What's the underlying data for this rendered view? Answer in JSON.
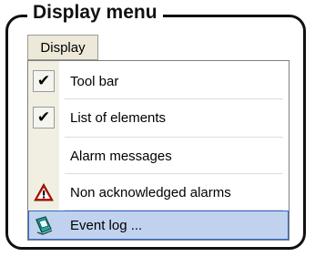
{
  "frame": {
    "title": "Display menu"
  },
  "menubar": {
    "display_label": "Display"
  },
  "menu": {
    "items": [
      {
        "label": "Tool bar",
        "checked": true,
        "icon": "checkmark-icon"
      },
      {
        "label": "List of elements",
        "checked": true,
        "icon": "checkmark-icon"
      },
      {
        "label": "Alarm messages",
        "checked": false,
        "icon": ""
      },
      {
        "label": "Non acknowledged alarms",
        "checked": false,
        "icon": "warning-icon"
      },
      {
        "label": "Event log ...",
        "checked": false,
        "icon": "event-log-book-icon",
        "highlighted": true
      }
    ],
    "checkmark_glyph": "✔"
  },
  "colors": {
    "highlight": "#c1d2ee",
    "highlight_border": "#316ac5",
    "warning_red": "#cc1100"
  }
}
